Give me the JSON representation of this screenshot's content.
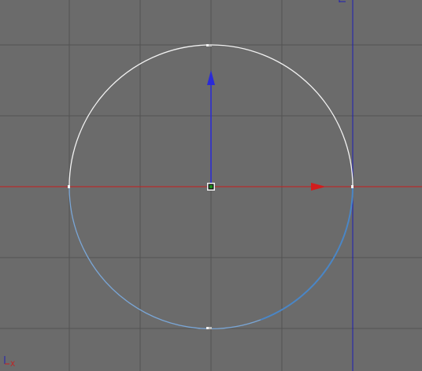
{
  "viewport": {
    "background_color": "#6b6b6b",
    "grid_color": "#535353",
    "horizontal_axis_color": "#c81e1e",
    "vertical_axis_color": "#1e1eb4",
    "circle_upper_color": "#f2f2f2",
    "circle_lower_color": "#7aa6d6",
    "circle_lower_right_color": "#4a86c6",
    "gizmo_x_arrow_color": "#d21c1c",
    "gizmo_y_arrow_color": "#2a2ad8",
    "pivot_color": "#1a8a1a",
    "corner_axis_x_label": "X",
    "corner_axis_x_color": "#c81e1e",
    "corner_axis_y_color": "#1e1eb4"
  }
}
